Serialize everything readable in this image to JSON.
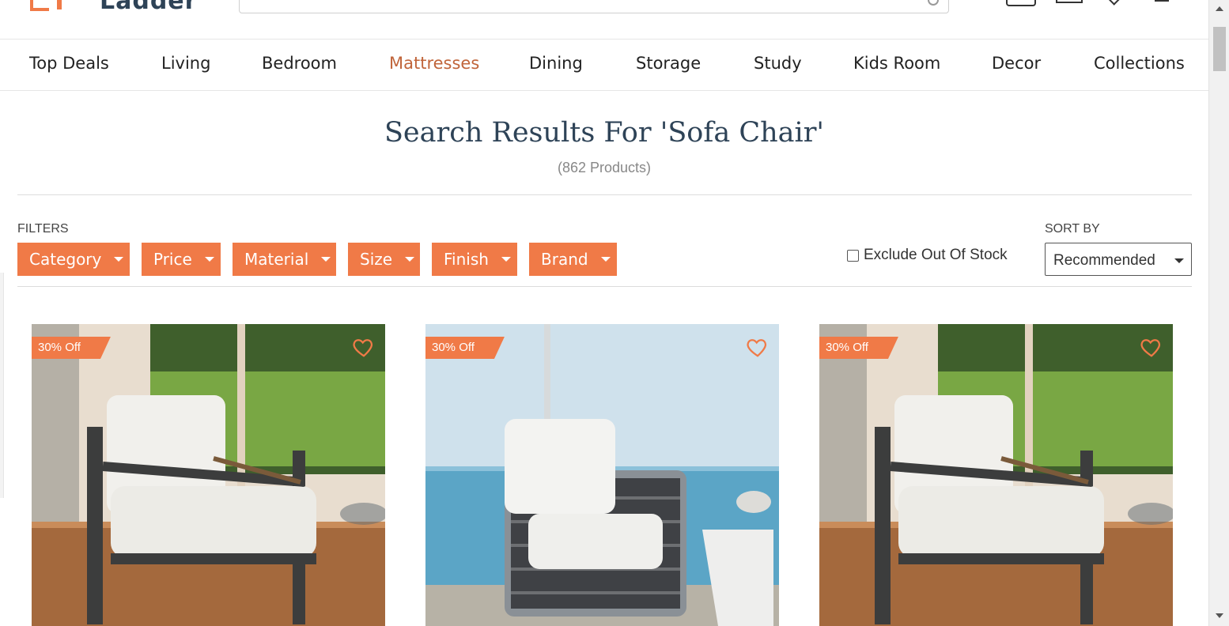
{
  "header": {
    "logo_text": "Ladder",
    "search_placeholder": ""
  },
  "nav": {
    "items": [
      {
        "label": "Top Deals"
      },
      {
        "label": "Living"
      },
      {
        "label": "Bedroom"
      },
      {
        "label": "Mattresses",
        "active": true
      },
      {
        "label": "Dining"
      },
      {
        "label": "Storage"
      },
      {
        "label": "Study"
      },
      {
        "label": "Kids Room"
      },
      {
        "label": "Decor"
      },
      {
        "label": "Collections"
      }
    ]
  },
  "results": {
    "title": "Search Results For 'Sofa Chair'",
    "count": "(862 Products)"
  },
  "filters": {
    "label": "FILTERS",
    "buttons": [
      "Category",
      "Price",
      "Material",
      "Size",
      "Finish",
      "Brand"
    ],
    "exclude_out_of_stock": "Exclude Out Of Stock",
    "exclude_checked": false
  },
  "sort": {
    "label": "SORT BY",
    "selected": "Recommended"
  },
  "products": [
    {
      "badge": "30% Off",
      "scene": "garden"
    },
    {
      "badge": "30% Off",
      "scene": "sea"
    },
    {
      "badge": "30% Off",
      "scene": "garden"
    }
  ],
  "colors": {
    "accent": "#f07a47",
    "active_nav": "#c0643a",
    "title": "#2e4357"
  }
}
